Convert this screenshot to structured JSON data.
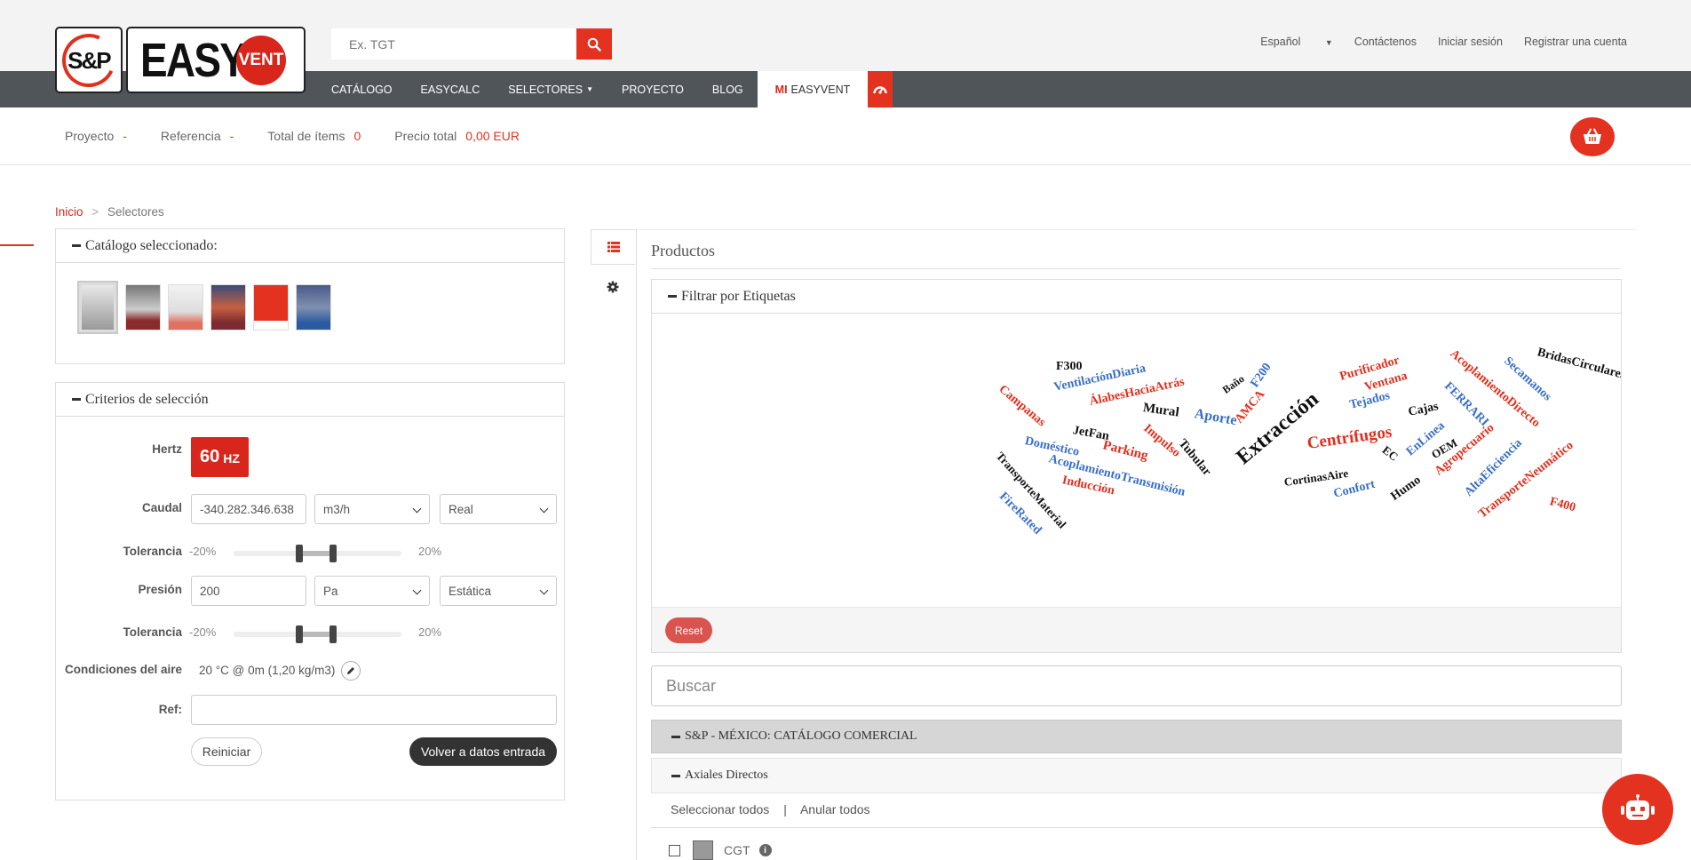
{
  "logo": {
    "sp": "S&P",
    "easy": "EASY",
    "vent": "VENT"
  },
  "search": {
    "placeholder": "Ex. TGT"
  },
  "toplinks": {
    "lang": "Español",
    "contact": "Contáctenos",
    "login": "Iniciar sesión",
    "register": "Registrar una cuenta"
  },
  "nav": {
    "items": [
      "CATÁLOGO",
      "EASYCALC",
      "SELECTORES",
      "PROYECTO",
      "BLOG"
    ],
    "active_prefix": "MI",
    "active_label": "EASYVENT"
  },
  "project": {
    "proyecto_label": "Proyecto",
    "proyecto_val": "-",
    "referencia_label": "Referencia",
    "referencia_val": "-",
    "total_label": "Total de ítems",
    "total_val": "0",
    "precio_label": "Precio total",
    "precio_val": "0,00 EUR"
  },
  "breadcrumb": {
    "home": "Inicio",
    "sep": ">",
    "current": "Selectores"
  },
  "catalog": {
    "title": "Catálogo seleccionado:"
  },
  "criteria": {
    "title": "Criterios de selección",
    "hertz_label": "Hertz",
    "hertz_value": "60",
    "hertz_unit": "HZ",
    "caudal_label": "Caudal",
    "caudal_value": "-340.282.346.638",
    "caudal_unit": "m3/h",
    "caudal_mode": "Real",
    "tol_label": "Tolerancia",
    "tol_min": "-20%",
    "tol_max": "20%",
    "presion_label": "Presión",
    "presion_value": "200",
    "presion_unit": "Pa",
    "presion_mode": "Estática",
    "aire_label": "Condiciones del aire",
    "aire_value": "20 °C @ 0m (1,20 kg/m3)",
    "ref_label": "Ref:",
    "ref_value": "",
    "reset_label": "Reiniciar",
    "back_label": "Volver a datos entrada"
  },
  "products": {
    "title": "Productos",
    "filter_title": "Filtrar por Etiquetas",
    "reset_label": "Reset",
    "search_placeholder": "Buscar",
    "category": "S&P - MÉXICO: CATÁLOGO COMERCIAL",
    "subcategory": "Axiales Directos",
    "select_all": "Seleccionar todos",
    "sep": "|",
    "unselect_all": "Anular todos",
    "first_product": "CGT"
  },
  "tags": [
    "Campanas",
    "F300",
    "VentilaciónDiaria",
    "ÁlabesHaciaAtrás",
    "Baño",
    "F200",
    "Purificador",
    "Ventana",
    "AcoplamientoDirecto",
    "Secamanos",
    "BridasCirculares",
    "FERRARI",
    "Mural",
    "Aporte",
    "AMCA",
    "Extracción",
    "Tejados",
    "Cajas",
    "JetFan",
    "Doméstico",
    "Impulso",
    "Tubular",
    "Parking",
    "AcoplamientoTransmisión",
    "Centrífugos",
    "EnLínea",
    "OEM",
    "EC",
    "Agropecuario",
    "TransporteMaterial",
    "Inducción",
    "CortinasAire",
    "Confort",
    "Humo",
    "AltaEficiencia",
    "TransporteNeumático",
    "F400",
    "FireRated"
  ],
  "colors": {
    "accent": "#e3321f",
    "nav": "#505559",
    "tag_red": "#e0301e",
    "tag_blue": "#3a6fc6",
    "tag_black": "#111111"
  }
}
